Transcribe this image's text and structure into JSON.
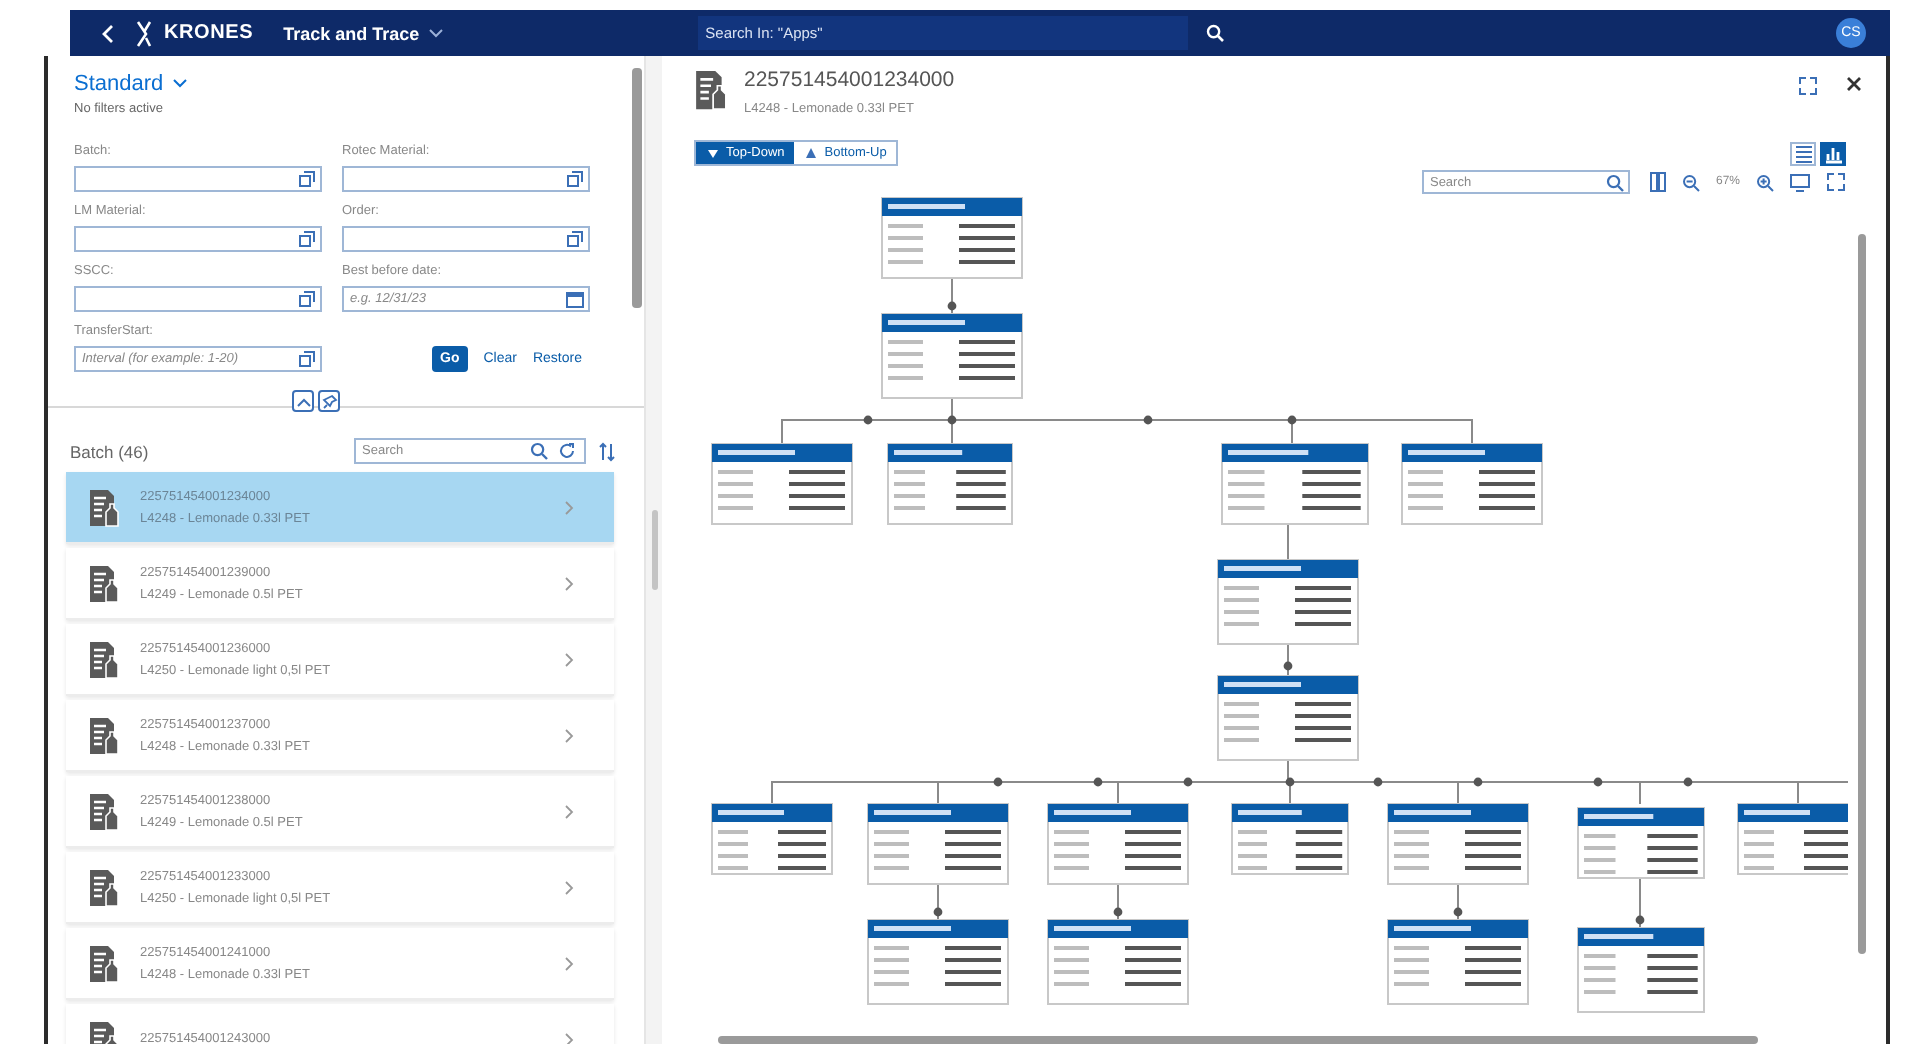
{
  "top_bar": {
    "logo": "KRONES",
    "app_title": "Track and Trace",
    "search": {
      "placeholder": "Search In: \"Apps\""
    },
    "avatar": "CS"
  },
  "filter_bar": {
    "variant": "Standard",
    "status": "No filters active",
    "fields": [
      {
        "label": "Batch:",
        "kind": "value_help"
      },
      {
        "label": "Rotec Material:",
        "kind": "value_help"
      },
      {
        "label": "LM Material:",
        "kind": "value_help"
      },
      {
        "label": "Order:",
        "kind": "value_help"
      },
      {
        "label": "SSCC:",
        "kind": "value_help"
      },
      {
        "label": "Best before date:",
        "kind": "date",
        "placeholder": "e.g. 12/31/23"
      },
      {
        "label": "TransferStart:",
        "kind": "value_help",
        "placeholder": "Interval (for example: 1-20)"
      }
    ],
    "buttons": [
      {
        "label": "Go",
        "kind": "primary"
      },
      {
        "label": "Clear",
        "kind": "plain"
      },
      {
        "label": "Restore",
        "kind": "plain"
      }
    ]
  },
  "batch_list": {
    "title": "Batch (46)",
    "search": {
      "placeholder": "Search"
    },
    "items": [
      {
        "id": "225751454001234000",
        "description": "L4248 - Lemonade 0.33l PET",
        "selected": true
      },
      {
        "id": "225751454001239000",
        "description": "L4249 - Lemonade 0.5l PET",
        "selected": false
      },
      {
        "id": "225751454001236000",
        "description": "L4250 - Lemonade light 0,5l PET",
        "selected": false
      },
      {
        "id": "225751454001237000",
        "description": "L4248 - Lemonade 0.33l PET",
        "selected": false
      },
      {
        "id": "225751454001238000",
        "description": "L4249 - Lemonade 0.5l PET",
        "selected": false
      },
      {
        "id": "225751454001233000",
        "description": "L4250 - Lemonade light 0,5l PET",
        "selected": false
      },
      {
        "id": "225751454001241000",
        "description": "L4248 - Lemonade 0.33l PET",
        "selected": false
      },
      {
        "id": "225751454001243000",
        "selected": false
      }
    ]
  },
  "detail": {
    "title": "225751454001234000",
    "subtitle": "L4248 - Lemonade 0.33l PET",
    "direction": [
      {
        "label": "Top-Down",
        "kind": "down",
        "selected": true
      },
      {
        "label": "Bottom-Up",
        "kind": "up",
        "selected": false
      }
    ],
    "views": [
      {
        "kind": "table",
        "selected": false
      },
      {
        "kind": "chart",
        "selected": true
      }
    ],
    "search": {
      "placeholder": "Search"
    },
    "zoom": "67%"
  }
}
